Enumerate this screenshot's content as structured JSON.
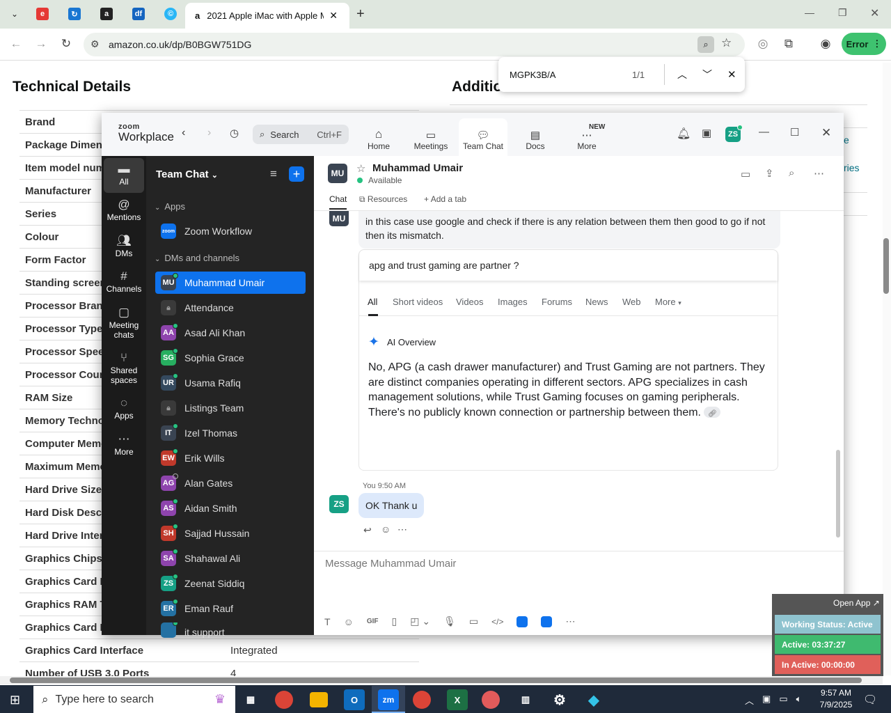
{
  "browser": {
    "active_tab_title": "2021 Apple iMac with Apple M",
    "url": "amazon.co.uk/dp/B0BGW751DG",
    "profile_button": "Error",
    "find": {
      "query": "MGPK3B/A",
      "count": "1/1"
    }
  },
  "amazon": {
    "tech_title": "Technical Details",
    "additional_title": "Additio",
    "right_snippets": [
      "e",
      "ries"
    ],
    "rows": [
      "Brand",
      "Package Dimensi",
      "Item model num",
      "Manufacturer",
      "Series",
      "Colour",
      "Form Factor",
      "Standing screen",
      "Processor Brand",
      "Processor Type",
      "Processor Speed",
      "Processor Count",
      "RAM Size",
      "Memory Technol",
      "Computer Memo",
      "Maximum Memo",
      "Hard Drive Size",
      "Hard Disk Descri",
      "Hard Drive Interf",
      "Graphics Chipset",
      "Graphics Card De",
      "Graphics RAM Ty",
      "Graphics Card Ra",
      "Graphics Card Interface",
      "Number of USB 3.0 Ports"
    ],
    "interface_value": "Integrated",
    "usb_value": "4"
  },
  "zoom": {
    "logo_top": "zoom",
    "logo_bottom": "Workplace",
    "search_label": "Search",
    "search_shortcut": "Ctrl+F",
    "nav": [
      "Home",
      "Meetings",
      "Team Chat",
      "Docs",
      "More"
    ],
    "new_badge": "NEW",
    "user_initials": "ZS",
    "rail": [
      "All",
      "Mentions",
      "DMs",
      "Channels",
      "Meeting chats",
      "Shared spaces",
      "Apps",
      "More"
    ],
    "panel_title": "Team Chat",
    "apps_header": "Apps",
    "zoom_workflow": "Zoom Workflow",
    "dm_header": "DMs and channels",
    "contacts": [
      {
        "initials": "MU",
        "name": "Muhammad Umair",
        "color": "#3a4452",
        "status": "online"
      },
      {
        "initials": "",
        "name": "Attendance",
        "color": "#3a3a3a",
        "status": "lock"
      },
      {
        "initials": "AA",
        "name": "Asad Ali Khan",
        "color": "#8e44ad",
        "status": "online"
      },
      {
        "initials": "SG",
        "name": "Sophia Grace",
        "color": "#27ae60",
        "status": "online"
      },
      {
        "initials": "UR",
        "name": "Usama Rafiq",
        "color": "#34495e",
        "status": "online"
      },
      {
        "initials": "",
        "name": "Listings Team",
        "color": "#3a3a3a",
        "status": "lock"
      },
      {
        "initials": "IT",
        "name": "Izel Thomas",
        "color": "#3a4452",
        "status": "online"
      },
      {
        "initials": "EW",
        "name": "Erik Wills",
        "color": "#c0392b",
        "status": "online"
      },
      {
        "initials": "AG",
        "name": "Alan Gates",
        "color": "#8e44ad",
        "status": "offline"
      },
      {
        "initials": "AS",
        "name": "Aidan Smith",
        "color": "#8e44ad",
        "status": "online"
      },
      {
        "initials": "SH",
        "name": "Sajjad Hussain",
        "color": "#c0392b",
        "status": "online"
      },
      {
        "initials": "SA",
        "name": "Shahawal Ali",
        "color": "#8e44ad",
        "status": "online"
      },
      {
        "initials": "ZS",
        "name": "Zeenat Siddiq",
        "color": "#16a085",
        "status": "online"
      },
      {
        "initials": "ER",
        "name": "Eman Rauf",
        "color": "#2471a3",
        "status": "online"
      },
      {
        "initials": "",
        "name": "it support",
        "color": "#2471a3",
        "status": "online"
      }
    ],
    "chat": {
      "contact_initials": "MU",
      "contact_name": "Muhammad Umair",
      "contact_status": "Available",
      "tabs": [
        "Chat",
        "Resources",
        "Add a tab"
      ],
      "msg1": "in this case use google and check if there is any relation between them then good to go if not then its mismatch.",
      "query": "apg and trust gaming are partner ?",
      "google_tabs": [
        "All",
        "Short videos",
        "Videos",
        "Images",
        "Forums",
        "News",
        "Web",
        "More"
      ],
      "ai_label": "AI Overview",
      "ai_text": "No, APG (a cash drawer manufacturer) and Trust Gaming are not partners. They are distinct companies operating in different sectors. APG specializes in cash management solutions, while Trust Gaming focuses on gaming peripherals. There's no publicly known connection or partnership between them.",
      "my_initials": "ZS",
      "my_sender": "You",
      "my_time": "9:50 AM",
      "my_msg": "OK Thank u",
      "composer_placeholder": "Message Muhammad Umair"
    }
  },
  "status_widget": {
    "open_app": "Open App",
    "working": "Working Status: Active",
    "active": "Active: 03:37:27",
    "inactive": "In Active: 00:00:00"
  },
  "taskbar": {
    "search_placeholder": "Type here to search",
    "time": "9:57 AM",
    "date": "7/9/2025",
    "zoom_app": "zm"
  }
}
